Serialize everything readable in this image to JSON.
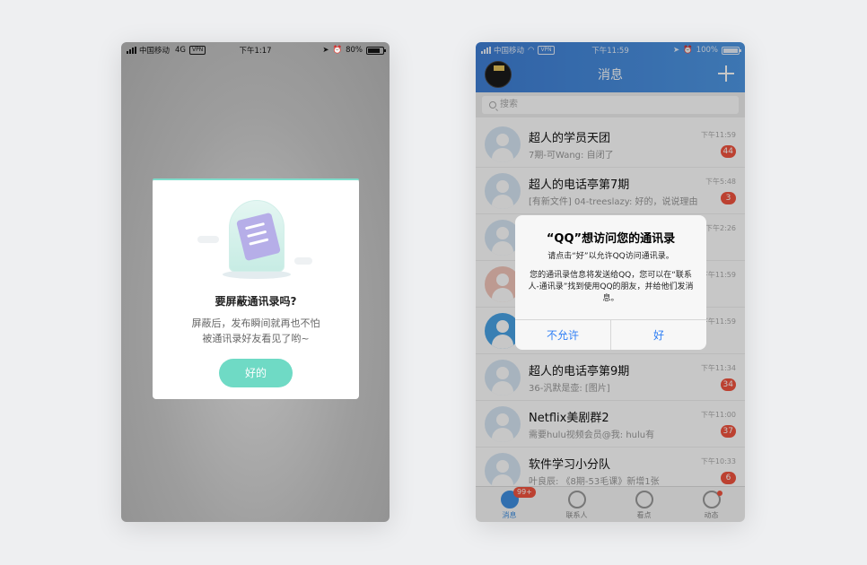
{
  "left": {
    "status": {
      "carrier": "中国移动",
      "network": "4G",
      "vpn": "VPN",
      "time": "下午1:17",
      "battery": "80%"
    },
    "dialog": {
      "title": "要屏蔽通讯录吗?",
      "desc_line1": "屏蔽后，发布瞬间就再也不怕",
      "desc_line2": "被通讯录好友看见了哟~",
      "ok_label": "好的"
    }
  },
  "right": {
    "status": {
      "carrier": "中国移动",
      "vpn": "VPN",
      "time": "下午11:59",
      "battery": "100%"
    },
    "header": {
      "title": "消息"
    },
    "search": {
      "placeholder": "搜索"
    },
    "chats": [
      {
        "name": "超人的学员天团",
        "msg": "7期-可Wang: 自闭了",
        "time": "下午11:59",
        "badge": "44"
      },
      {
        "name": "超人的电话亭第7期",
        "msg": "[有新文件] 04-treeslazy: 好的，说说理由",
        "time": "下午5:48",
        "badge": "3"
      },
      {
        "name": "",
        "msg": "",
        "time": "下午2:26",
        "badge": ""
      },
      {
        "name": "",
        "msg": "",
        "time": "下午11:59",
        "badge": ""
      },
      {
        "name": "",
        "msg": "",
        "time": "下午11:59",
        "badge": ""
      },
      {
        "name": "超人的电话亭第9期",
        "msg": "36-汎默是壶: [图片]",
        "time": "下午11:34",
        "badge": "34"
      },
      {
        "name": "Netflix美剧群2",
        "msg": "需要hulu视频会员@我: hulu有",
        "time": "下午11:00",
        "badge": "37"
      },
      {
        "name": "软件学习小分队",
        "msg": "叶良辰: 《8期-53毛课》新增1张",
        "time": "下午10:33",
        "badge": "6"
      }
    ],
    "tabs": [
      {
        "label": "消息",
        "badge": "99+"
      },
      {
        "label": "联系人"
      },
      {
        "label": "看点"
      },
      {
        "label": "动态"
      }
    ],
    "alert": {
      "title": "“QQ”想访问您的通讯录",
      "subtitle": "请点击“好”以允许QQ访问通讯录。",
      "body": "您的通讯录信息将发送给QQ，您可以在“联系人-通讯录”找到使用QQ的朋友，并给他们发消息。",
      "deny_label": "不允许",
      "allow_label": "好"
    }
  },
  "colors": {
    "qq_blue": "#3f7fd6",
    "mint": "#6fdac5",
    "badge_red": "#f1543f"
  }
}
